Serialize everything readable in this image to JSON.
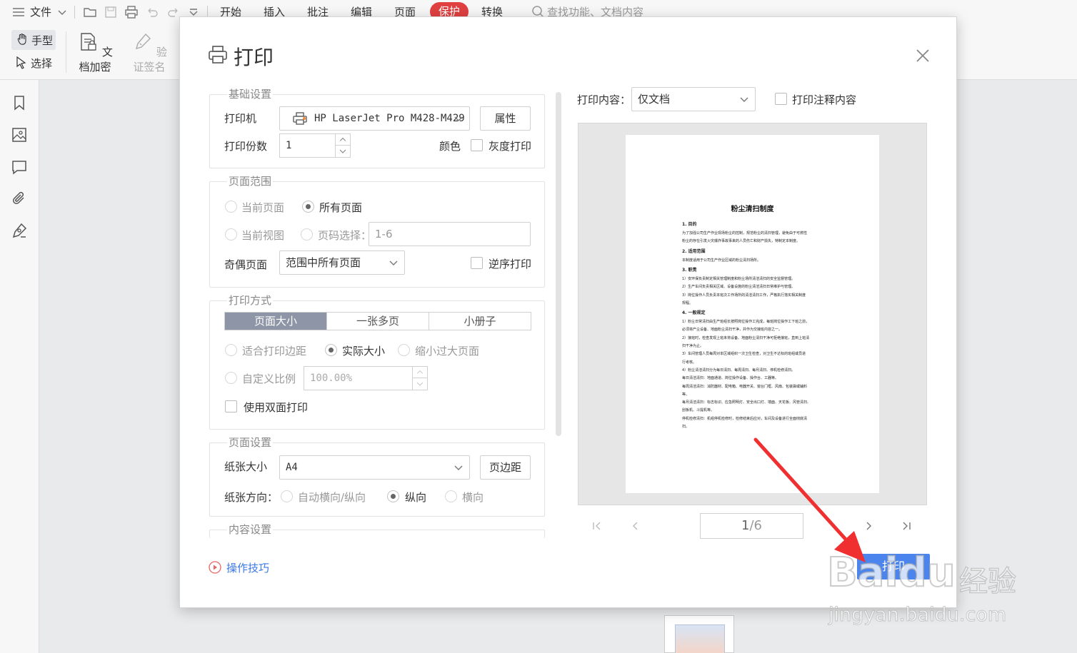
{
  "menubar": {
    "file": "文件",
    "tabs": [
      "开始",
      "插入",
      "批注",
      "编辑",
      "页面",
      "保护",
      "转换"
    ],
    "search_placeholder": "查找功能、文档内容"
  },
  "ribbon": {
    "hand": "手型",
    "select": "选择",
    "encrypt": "文档加密",
    "verify_sign": "验证签名"
  },
  "dialog": {
    "title": "打印",
    "basic": {
      "title": "基础设置",
      "printer_label": "打印机",
      "printer_value": "HP LaserJet Pro M428-M429",
      "properties_button": "属性",
      "copies_label": "打印份数",
      "copies_value": "1",
      "color_label": "颜色",
      "grayscale_label": "灰度打印"
    },
    "range": {
      "title": "页面范围",
      "current_page": "当前页面",
      "all_pages": "所有页面",
      "current_view": "当前视图",
      "page_select": "页码选择：",
      "page_select_value": "1-6",
      "odd_even_label": "奇偶页面",
      "odd_even_value": "范围中所有页面",
      "reverse_label": "逆序打印"
    },
    "mode": {
      "title": "打印方式",
      "tabs": [
        "页面大小",
        "一张多页",
        "小册子"
      ],
      "fit_margin": "适合打印边距",
      "actual_size": "实际大小",
      "shrink_large": "缩小过大页面",
      "custom_scale": "自定义比例",
      "custom_scale_value": "100.00%",
      "duplex_label": "使用双面打印"
    },
    "page_setup": {
      "title": "页面设置",
      "paper_size_label": "纸张大小",
      "paper_size_value": "A4",
      "margins_button": "页边距",
      "orientation_label": "纸张方向：",
      "auto": "自动横向/纵向",
      "portrait": "纵向",
      "landscape": "横向"
    },
    "content_setup": {
      "title": "内容设置"
    },
    "print_content_label": "打印内容：",
    "print_content_value": "仅文档",
    "print_annotations_label": "打印注释内容",
    "preview": {
      "doc_title": "粉尘清扫制度",
      "lines": [
        {
          "t": "1. 目的",
          "h": true
        },
        {
          "t": "为了加强公司生产作业现场粉尘的控制，规范粉尘的清扫管理，避免由于可燃性",
          "h": false
        },
        {
          "t": "粉尘的存在引发火灾爆炸事故事来的人员伤亡和财产损失，特制定本制度。",
          "h": false
        },
        {
          "t": "2. 适用范围",
          "h": true
        },
        {
          "t": "本制度适用于公司生产作业区域的粉尘清扫场所。",
          "h": false
        },
        {
          "t": "3. 职责",
          "h": true
        },
        {
          "t": "1）安环保负责制定相关管理制度和粉尘场所清洁清扫的安全监督管理。",
          "h": false
        },
        {
          "t": "2）生产车间负责相关区域、设备设施的粉尘清洁清扫日常维护与管理。",
          "h": false
        },
        {
          "t": "3）岗位操作人员负责本班次工作场所的清洁清扫工作，严格执行落实相关制度",
          "h": false
        },
        {
          "t": "规程。",
          "h": false
        },
        {
          "t": "4. 一般规定",
          "h": true
        },
        {
          "t": "1）粉尘日常清扫由生产班组长按照岗位操作工完成，每班岗位操作工下班之前，",
          "h": false
        },
        {
          "t": "必须将产尘设备、地面粉尘清扫干净，并作为交接班内容之一。",
          "h": false
        },
        {
          "t": "2）接班时，检查发现上班未将设备、地面粉尘清扫干净可拒绝接班，直到上班清",
          "h": false
        },
        {
          "t": "扫干净为止。",
          "h": false
        },
        {
          "t": "3）车间管理人员每周对本区域组织一次卫生检查，对卫生不达标的班组或员进",
          "h": false
        },
        {
          "t": "行考核。",
          "h": false
        },
        {
          "t": "4）粉尘清洁清扫分为每日清扫、每周清扫、每月清扫、停机检修清扫。",
          "h": false
        },
        {
          "t": "每日清洁清扫：地面通道、岗位操作设备、操作台、工器等。",
          "h": false
        },
        {
          "t": "每周清洁清扫：消防器材、配电箱、电器开关、窗台门框、风扇、包装袋或辅料",
          "h": false
        },
        {
          "t": "等。",
          "h": false
        },
        {
          "t": "每月清洁清扫：标志标识、应急照明灯、安全出口灯、墙面、天花板、风管清扫、",
          "h": false
        },
        {
          "t": "刮板机、斗提机等。",
          "h": false
        },
        {
          "t": "停机检修清扫：机组停机检修时，检修结束后应对，车间及设备进行全面彻底清",
          "h": false
        },
        {
          "t": "扫。",
          "h": false
        }
      ]
    },
    "pagination": {
      "current": "1",
      "total": "6"
    },
    "print_button": "打印",
    "tips_link": "操作技巧"
  },
  "watermark": {
    "brand": "Baidu",
    "brand_cn": "经验",
    "url": "jingyan.baidu.com"
  },
  "colors": {
    "accent": "#4a84ec",
    "protect_tab": "#e04040",
    "arrow": "#f03030"
  }
}
